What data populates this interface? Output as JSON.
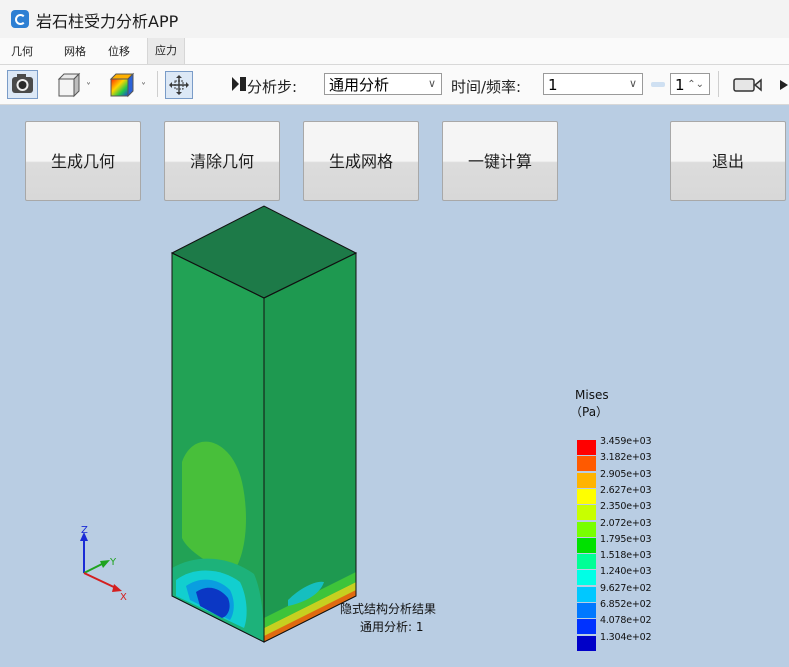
{
  "window": {
    "title": "岩石柱受力分析APP"
  },
  "menu": [
    "几何",
    "网格",
    "位移",
    "应力"
  ],
  "toolbar": {
    "step_label": "分析步:",
    "step_value": "通用分析",
    "time_label": "时间/频率:",
    "time_value": "1",
    "frame_value": "1"
  },
  "buttons": {
    "generate_geometry": "生成几何",
    "clear_geometry": "清除几何",
    "generate_mesh": "生成网格",
    "one_click_compute": "一键计算",
    "exit": "退出"
  },
  "axes": {
    "z": "Z",
    "y": "Y",
    "x": "X"
  },
  "legend": {
    "title": "Mises",
    "unit": "（Pa）",
    "values": [
      "3.459e+03",
      "3.182e+03",
      "2.905e+03",
      "2.627e+03",
      "2.350e+03",
      "2.072e+03",
      "1.795e+03",
      "1.518e+03",
      "1.240e+03",
      "9.627e+02",
      "6.852e+02",
      "4.078e+02",
      "1.304e+02"
    ],
    "colors": [
      "#ff0000",
      "#ff5a00",
      "#ffb400",
      "#ffff00",
      "#c8ff00",
      "#78ff00",
      "#00e100",
      "#00ff96",
      "#00ffe6",
      "#00c8ff",
      "#0078ff",
      "#0032ff",
      "#0000c8"
    ]
  },
  "result": {
    "line1": "隐式结构分析结果",
    "line2": "通用分析: 1"
  },
  "icons": [
    "camera-icon",
    "cube-view-icon",
    "render-mode-icon",
    "fit-view-icon",
    "step-icon",
    "record-icon"
  ]
}
